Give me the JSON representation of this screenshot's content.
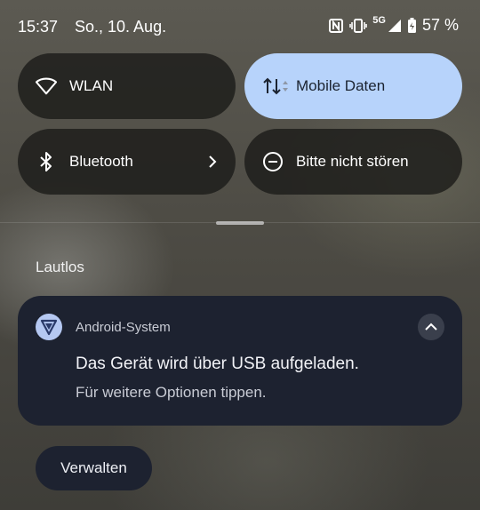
{
  "status_bar": {
    "time": "15:37",
    "date": "So., 10. Aug.",
    "network_type": "5G",
    "battery": "57 %"
  },
  "quick_settings": {
    "wlan": {
      "label": "WLAN",
      "icon": "wifi-icon"
    },
    "mobile_data": {
      "label": "Mobile Daten",
      "icon": "data-transfer-icon",
      "active": true
    },
    "bluetooth": {
      "label": "Bluetooth",
      "icon": "bluetooth-icon"
    },
    "dnd": {
      "label": "Bitte nicht stören",
      "icon": "do-not-disturb-icon"
    }
  },
  "section": {
    "label": "Lautlos"
  },
  "notification": {
    "app_name": "Android-System",
    "title": "Das Gerät wird über USB aufgeladen.",
    "body": "Für weitere Optionen tippen."
  },
  "manage_button": {
    "label": "Verwalten"
  },
  "colors": {
    "active_tile": "#b7d3fb",
    "notification_bg": "#1d2230",
    "app_icon_bg": "#b5c8f2"
  }
}
